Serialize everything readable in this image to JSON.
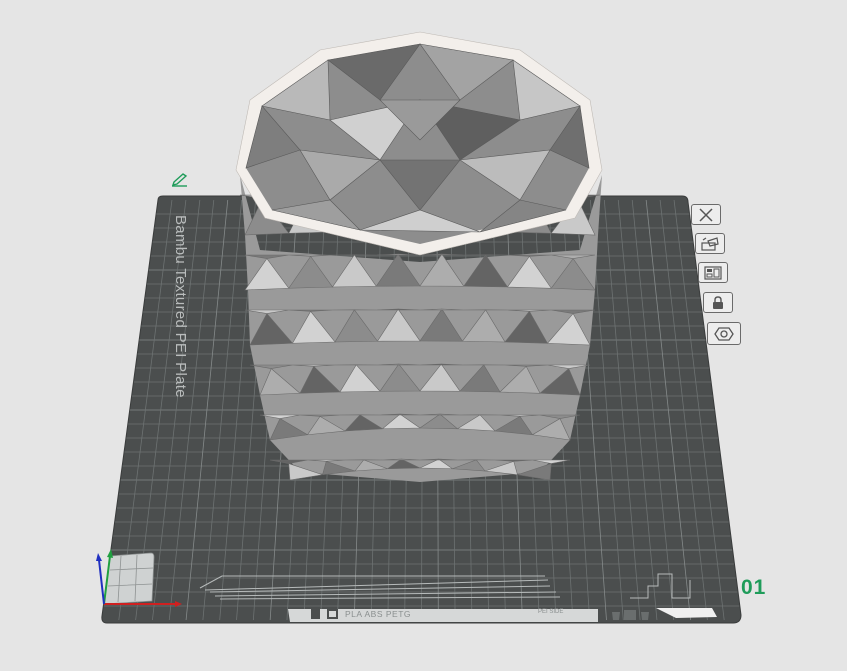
{
  "app": {
    "viewport": "3D prepare view"
  },
  "plate": {
    "name": "Bambu Textured PEI Plate",
    "number": "01",
    "filament_note": "PLA ABS PETG",
    "filament_sub": "PEI SIDE"
  },
  "side_toolbar": [
    {
      "name": "close-plate-button",
      "icon": "x-icon"
    },
    {
      "name": "auto-orient-button",
      "icon": "orient-icon"
    },
    {
      "name": "arrange-button",
      "icon": "arrange-icon"
    },
    {
      "name": "lock-plate-button",
      "icon": "lock-icon"
    },
    {
      "name": "plate-settings-button",
      "icon": "hex-nut-icon"
    }
  ],
  "colors": {
    "background": "#e5e5e5",
    "plate": "#4b4e4e",
    "grid": "#6d7272",
    "model_light": "#bdbdbd",
    "model_dark": "#5e5e5e",
    "accent_green": "#1f9c5a",
    "axis_x": "#d02020",
    "axis_y": "#20a040",
    "axis_z": "#2030c0"
  }
}
